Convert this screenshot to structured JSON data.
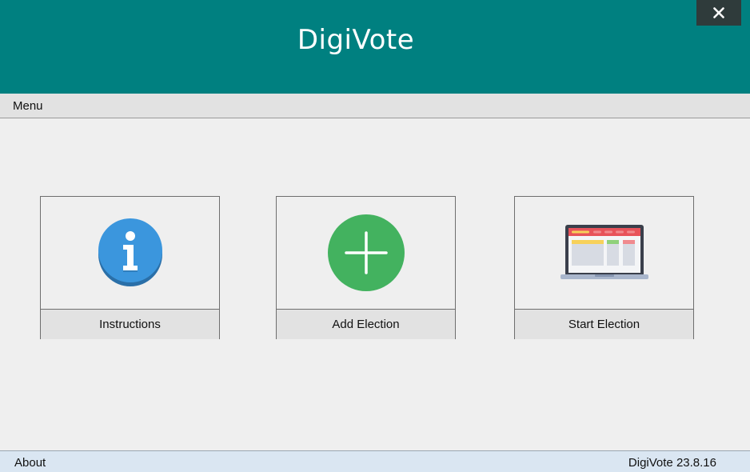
{
  "app": {
    "title": "DigiVote",
    "brand_color": "#008080"
  },
  "window": {
    "close_icon": "close-icon"
  },
  "menubar": {
    "menu_label": "Menu"
  },
  "tiles": [
    {
      "label": "Instructions",
      "icon": "info-icon",
      "color": "#3b96dd"
    },
    {
      "label": "Add Election",
      "icon": "plus-icon",
      "color": "#43b25f"
    },
    {
      "label": "Start Election",
      "icon": "laptop-icon",
      "color": "#3a3f4b"
    }
  ],
  "statusbar": {
    "about_label": "About",
    "version_text": "DigiVote 23.8.16"
  }
}
